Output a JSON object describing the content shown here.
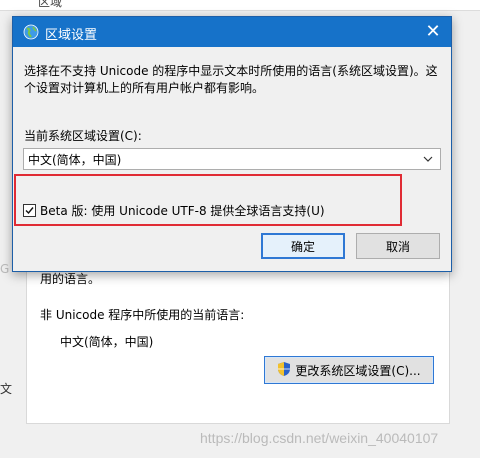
{
  "background_window": {
    "title": "区域",
    "fragment_text": "用的语言。",
    "nonunicode_label": "非 Unicode 程序中所使用的当前语言:",
    "current_language": "中文(简体，中国)",
    "change_locale_button": "更改系统区域设置(C)...",
    "left_fragment": "文",
    "left_fragment2": "G"
  },
  "dialog": {
    "title": "区域设置",
    "description": "选择在不支持 Unicode 的程序中显示文本时所使用的语言(系统区域设置)。这个设置对计算机上的所有用户帐户都有影响。",
    "current_locale_label": "当前系统区域设置(C):",
    "selected_locale": "中文(简体，中国)",
    "beta_checkbox_label": "Beta 版: 使用 Unicode UTF-8 提供全球语言支持(U)",
    "beta_checked": true,
    "ok_label": "确定",
    "cancel_label": "取消"
  },
  "watermark": "https://blog.csdn.net/weixin_40040107",
  "colors": {
    "titlebar": "#1672c9",
    "highlight": "#e02b34",
    "focus_border": "#2f78d4"
  },
  "icons": {
    "dialog_icon": "globe-icon",
    "close": "close-icon",
    "dropdown": "chevron-down-icon",
    "shield": "shield-icon"
  }
}
